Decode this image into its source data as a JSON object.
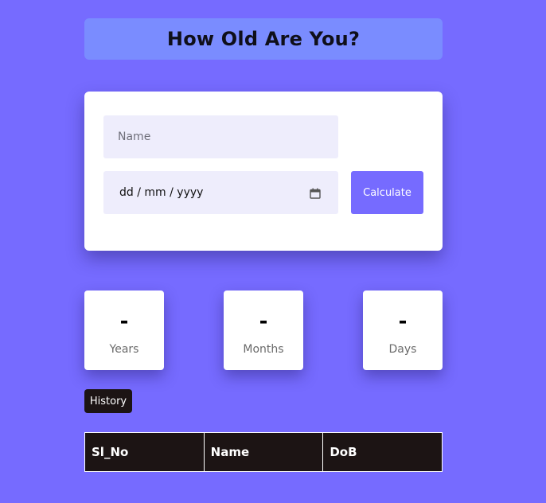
{
  "header": {
    "title": "How Old Are You?"
  },
  "form": {
    "name_placeholder": "Name",
    "date_placeholder": "dd / mm / yyyy",
    "calculate_label": "Calculate"
  },
  "results": [
    {
      "value": "-",
      "label": "Years"
    },
    {
      "value": "-",
      "label": "Months"
    },
    {
      "value": "-",
      "label": "Days"
    }
  ],
  "history": {
    "button_label": "History",
    "columns": [
      "Sl_No",
      "Name",
      "DoB"
    ]
  },
  "colors": {
    "background": "#766bff",
    "title_bar": "#7a8cff",
    "input_bg": "#eeedfc",
    "accent": "#766bff",
    "dark": "#1c1414"
  },
  "icons": {
    "date_picker": "calendar-icon"
  }
}
